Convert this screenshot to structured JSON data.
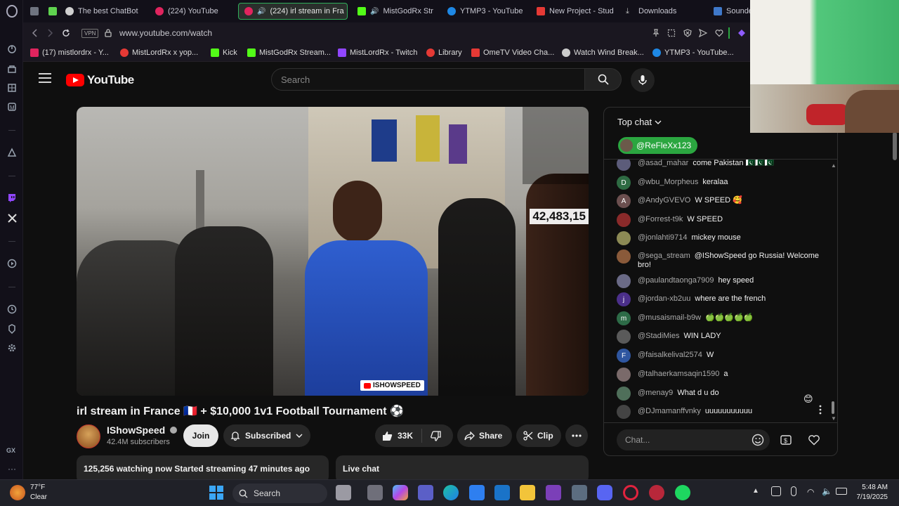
{
  "browser": {
    "tabs": [
      {
        "label": "",
        "color": "#6f7480"
      },
      {
        "label": "",
        "color": "#5fd34f"
      },
      {
        "label": "The best ChatBot",
        "color": "#cfcfcf"
      },
      {
        "label": "(224) YouTube",
        "color": "#e0245e"
      },
      {
        "label": "(224) irl stream in Fra",
        "color": "#e0245e"
      },
      {
        "label": "MistGodRx Str",
        "color": "#53fc18"
      },
      {
        "label": "YTMP3 - YouTube",
        "color": "#1e88e5"
      },
      {
        "label": "New Project - Stud",
        "color": "#e53935"
      },
      {
        "label": "Downloads",
        "color": "#bbbbbb"
      },
      {
        "label": "Sounde",
        "color": "#3f78c9"
      }
    ],
    "vpn_label": "VPN",
    "url": "www.youtube.com/watch",
    "bookmarks": [
      {
        "label": "(17) mistlordrx - Y...",
        "color": "#e0245e"
      },
      {
        "label": "MistLordRx x yop...",
        "color": "#e53935"
      },
      {
        "label": "Kick",
        "color": "#53fc18"
      },
      {
        "label": "MistGodRx Stream...",
        "color": "#53fc18"
      },
      {
        "label": "MistLordRx - Twitch",
        "color": "#9146ff"
      },
      {
        "label": "Library",
        "color": "#e53935"
      },
      {
        "label": "OmeTV Video Cha...",
        "color": "#e53935"
      },
      {
        "label": "Watch Wind Break...",
        "color": "#cccccc"
      },
      {
        "label": "YTMP3 - YouTube...",
        "color": "#1e88e5"
      }
    ],
    "sidebar_label": "GX"
  },
  "youtube": {
    "logo_text": "YouTube",
    "search_placeholder": "Search",
    "video": {
      "overlay_count": "42,483,15",
      "watermark": "ISHOWSPEED",
      "title": "irl stream in France 🇫🇷 + $10,000 1v1 Football Tournament ⚽"
    },
    "channel": {
      "name": "IShowSpeed",
      "subscribers": "42.4M subscribers",
      "join_label": "Join",
      "subscribed_label": "Subscribed"
    },
    "actions": {
      "like_count": "33K",
      "share_label": "Share",
      "clip_label": "Clip"
    },
    "description": {
      "stats": "125,256 watching now  Started streaming 47 minutes ago"
    },
    "live_chat_label": "Live chat"
  },
  "chat": {
    "mode": "Top chat",
    "pinned_user": "@ReFleXx123",
    "input_placeholder": "Chat...",
    "messages": [
      {
        "author": "@asad_mahar",
        "text": "come Pakistan 🇵🇰🇵🇰🇵🇰",
        "avatar_letter": "",
        "avatar_color": "#5c5c7a"
      },
      {
        "author": "@wbu_Morpheus",
        "text": "keralaa",
        "avatar_letter": "D",
        "avatar_color": "#2e6b43"
      },
      {
        "author": "@AndyGVEVO",
        "text": "W SPEED 🥰",
        "avatar_letter": "A",
        "avatar_color": "#6b4f4f"
      },
      {
        "author": "@Forrest-t9k",
        "text": "W SPEED",
        "avatar_letter": "",
        "avatar_color": "#8a2a2a"
      },
      {
        "author": "@jonlahti9714",
        "text": "mickey mouse",
        "avatar_letter": "",
        "avatar_color": "#8c8a55"
      },
      {
        "author": "@sega_stream",
        "text": "@IShowSpeed go Russia! Welcome bro!",
        "avatar_letter": "",
        "avatar_color": "#8a5a3a"
      },
      {
        "author": "@paulandtaonga7909",
        "text": "hey speed",
        "avatar_letter": "",
        "avatar_color": "#6a6a86"
      },
      {
        "author": "@jordan-xb2uu",
        "text": "where are the french",
        "avatar_letter": "j",
        "avatar_color": "#4b2f8a"
      },
      {
        "author": "@musaismail-b9w",
        "text": "🍏🍏🍏🍏🍏",
        "avatar_letter": "m",
        "avatar_color": "#2d6b47"
      },
      {
        "author": "@StadiMies",
        "text": "WIN LADY",
        "avatar_letter": "",
        "avatar_color": "#5a5a5a"
      },
      {
        "author": "@faisalkelival2574",
        "text": "W",
        "avatar_letter": "F",
        "avatar_color": "#2f56a0"
      },
      {
        "author": "@talhaerkamsaqin1590",
        "text": "a",
        "avatar_letter": "",
        "avatar_color": "#7a6a6a"
      },
      {
        "author": "@menay9",
        "text": "What d u do",
        "avatar_letter": "",
        "avatar_color": "#4f6f5a"
      },
      {
        "author": "@DJmamanffvnky",
        "text": "uuuuuuuuuuu",
        "avatar_letter": "",
        "avatar_color": "#444444"
      }
    ]
  },
  "taskbar": {
    "temperature": "77°F",
    "weather": "Clear",
    "search_label": "Search",
    "time": "5:48 AM",
    "date": "7/19/2025"
  }
}
